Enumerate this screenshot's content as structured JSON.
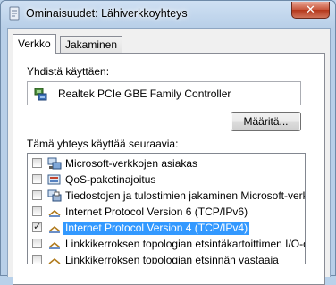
{
  "window": {
    "title": "Ominaisuudet: Lähiverkkoyhteys",
    "close_label": "✕"
  },
  "tabs": [
    {
      "label": "Verkko",
      "active": true
    },
    {
      "label": "Jakaminen",
      "active": false
    }
  ],
  "connect_using": {
    "label": "Yhdistä käyttäen:",
    "adapter": "Realtek PCIe GBE Family Controller",
    "configure_button": "Määritä..."
  },
  "items_section": {
    "label": "Tämä yhteys käyttää seuraavia:",
    "items": [
      {
        "label": "Microsoft-verkkojen asiakas",
        "checked": false,
        "icon": "network-client-icon",
        "selected": false
      },
      {
        "label": "QoS-paketinajoitus",
        "checked": false,
        "icon": "qos-scheduler-icon",
        "selected": false
      },
      {
        "label": "Tiedostojen ja tulostimien jakaminen Microsoft-verkoissa",
        "checked": false,
        "icon": "file-printer-sharing-icon",
        "selected": false
      },
      {
        "label": "Internet Protocol Version 6 (TCP/IPv6)",
        "checked": false,
        "icon": "protocol-icon",
        "selected": false
      },
      {
        "label": "Internet Protocol Version 4 (TCP/IPv4)",
        "checked": true,
        "icon": "protocol-icon",
        "selected": true
      },
      {
        "label": "Linkkikerroksen topologian etsintäkartoittimen I/O-ohjain",
        "checked": false,
        "icon": "protocol-icon",
        "selected": false
      },
      {
        "label": "Linkkikerroksen topologian etsinnän vastaaja",
        "checked": false,
        "icon": "protocol-icon",
        "selected": false
      }
    ]
  }
}
